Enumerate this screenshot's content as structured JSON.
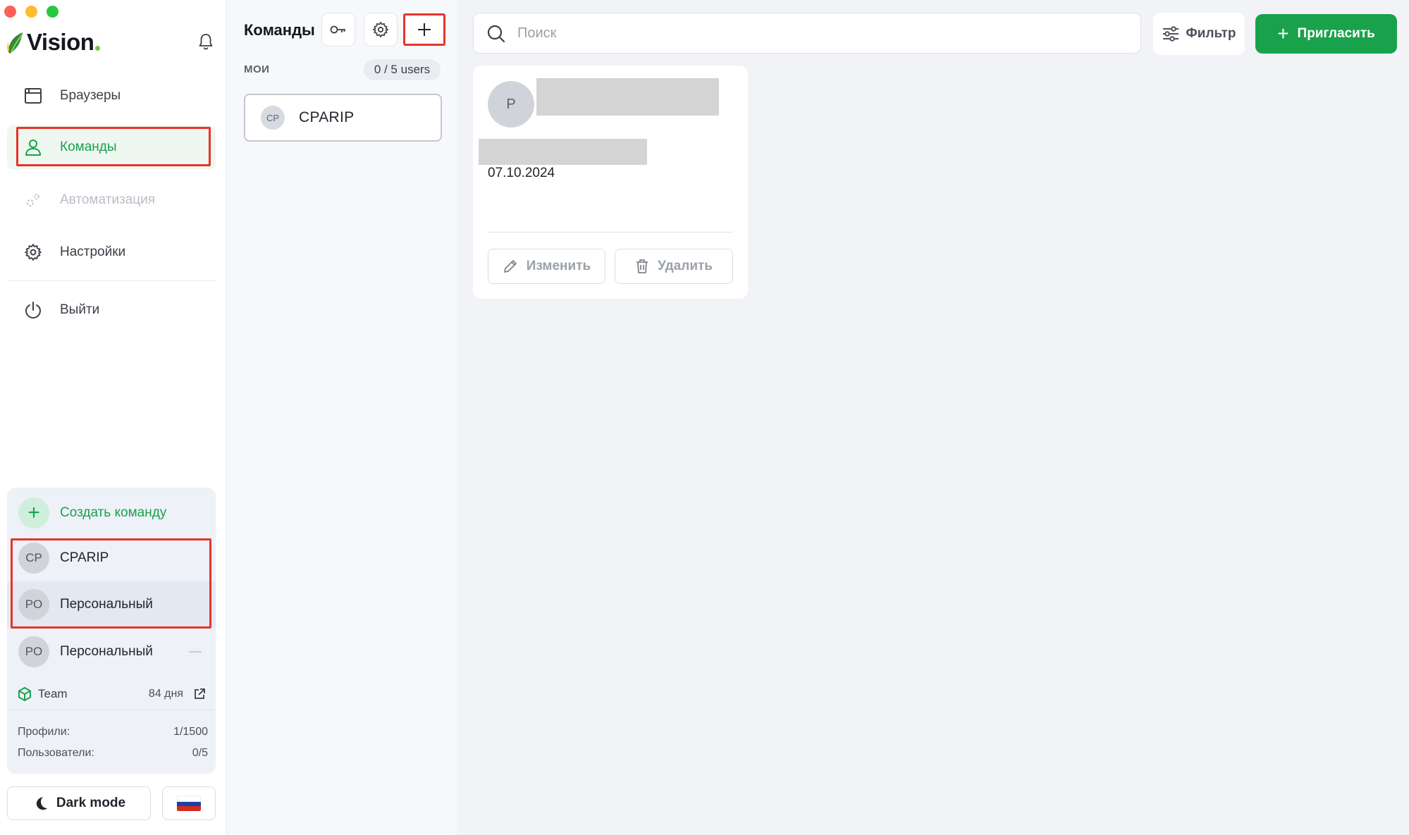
{
  "app": {
    "logo_text": "Vision"
  },
  "sidebar": {
    "nav": [
      {
        "label": "Браузеры",
        "icon": "browser-window-icon",
        "state": "normal"
      },
      {
        "label": "Команды",
        "icon": "user-icon",
        "state": "active"
      },
      {
        "label": "Автоматизация",
        "icon": "gears-icon",
        "state": "disabled"
      },
      {
        "label": "Настройки",
        "icon": "gear-icon",
        "state": "normal"
      },
      {
        "label": "Выйти",
        "icon": "power-icon",
        "state": "normal"
      }
    ],
    "create_team_label": "Создать команду",
    "teams": [
      {
        "initials": "CP",
        "name": "CPARIP"
      },
      {
        "initials": "PO",
        "name": "Персональный"
      },
      {
        "initials": "PO",
        "name": "Персональный"
      }
    ],
    "plan": {
      "name": "Team",
      "days": "84 дня"
    },
    "stats": [
      {
        "label": "Профили:",
        "value": "1/1500"
      },
      {
        "label": "Пользователи:",
        "value": "0/5"
      }
    ],
    "dark_mode_label": "Dark mode",
    "language": "ru"
  },
  "teams_panel": {
    "title": "Команды",
    "section_label": "МОИ",
    "users_badge": "0 / 5 users",
    "team": {
      "initials": "CP",
      "name": "CPARIP"
    }
  },
  "main": {
    "search_placeholder": "Поиск",
    "filter_label": "Фильтр",
    "invite_label": "Пригласить",
    "member": {
      "initials": "P",
      "date": "07.10.2024",
      "edit_label": "Изменить",
      "delete_label": "Удалить"
    }
  },
  "colors": {
    "accent_green": "#19a24b",
    "highlight_red": "#e5352b",
    "flag": [
      "#ffffff",
      "#1c3fa8",
      "#d52b1e"
    ]
  }
}
